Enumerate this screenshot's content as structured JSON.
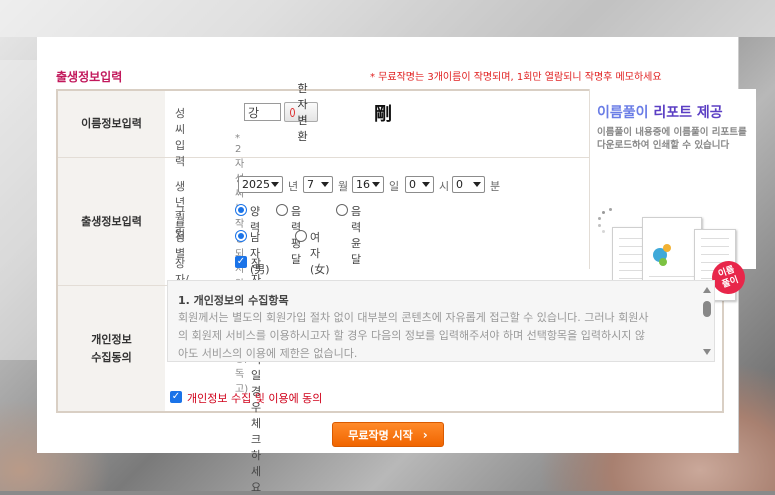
{
  "notice": "* 무료작명는 3개이름이 작명되며, 1회만 열람되니 작명후 메모하세요",
  "section_title": "출생정보입력",
  "name_row": {
    "label": "이름정보입력",
    "surname_label": "성씨입력",
    "surname_value": "강",
    "hanja_button": "한자변환",
    "hanja_char": "剛",
    "note": "* 2자 성씨는 작명 되지 않습니다. (남궁, 독고)"
  },
  "birth_row": {
    "label": "출생정보입력",
    "date_label": "생년월일",
    "year": "2025",
    "year_unit": "년",
    "month": "7",
    "month_unit": "월",
    "day": "16",
    "day_unit": "일",
    "hour": "0",
    "hour_unit": "시",
    "minute": "0",
    "minute_unit": "분",
    "calendar_label": "구 분",
    "calendar_options": [
      "양력",
      "음력평달",
      "음력윤달"
    ],
    "calendar_selected": 0,
    "gender_label": "성 별",
    "gender_options": [
      "남자(男)",
      "여자(女)"
    ],
    "gender_selected": 0,
    "eldest_label": "장자/장녀",
    "eldest_checkbox": "장자이거나 장녀일경우 체크하세요",
    "eldest_checked": true
  },
  "report": {
    "title_part1": "이름풀이",
    "title_part2": "리포트",
    "title_part3": "제공",
    "desc_line1": "이름풀이 내용중에 이름풀이 리포트를",
    "desc_line2": "다운로드하여 인쇄할 수 있습니다",
    "badge_line1": "이름",
    "badge_line2": "풀이"
  },
  "privacy_row": {
    "label_line1": "개인정보",
    "label_line2": "수집동의",
    "title": "1. 개인정보의 수집항목",
    "text_line1": "회원께서는 별도의 회원가입 절차 없이 대부분의 콘텐츠에 자유롭게 접근할 수 있습니다. 그러나 회원사",
    "text_line2": "의 회원제 서비스를 이용하시고자 할 경우 다음의 정보를 입력해주셔야 하며 선택항목을 입력하시지 않",
    "text_line3": "아도 서비스의 이용에 제한은 없습니다.",
    "consent_label": "개인정보 수집 및 이용에 동의",
    "consent_checked": true
  },
  "start_button": "무료작명 시작",
  "colors": {
    "title": "#c2185b",
    "notice": "#e02020",
    "accent_blue": "#1a73e8",
    "button_orange": "#f57c00",
    "badge_red": "#e8264a"
  }
}
